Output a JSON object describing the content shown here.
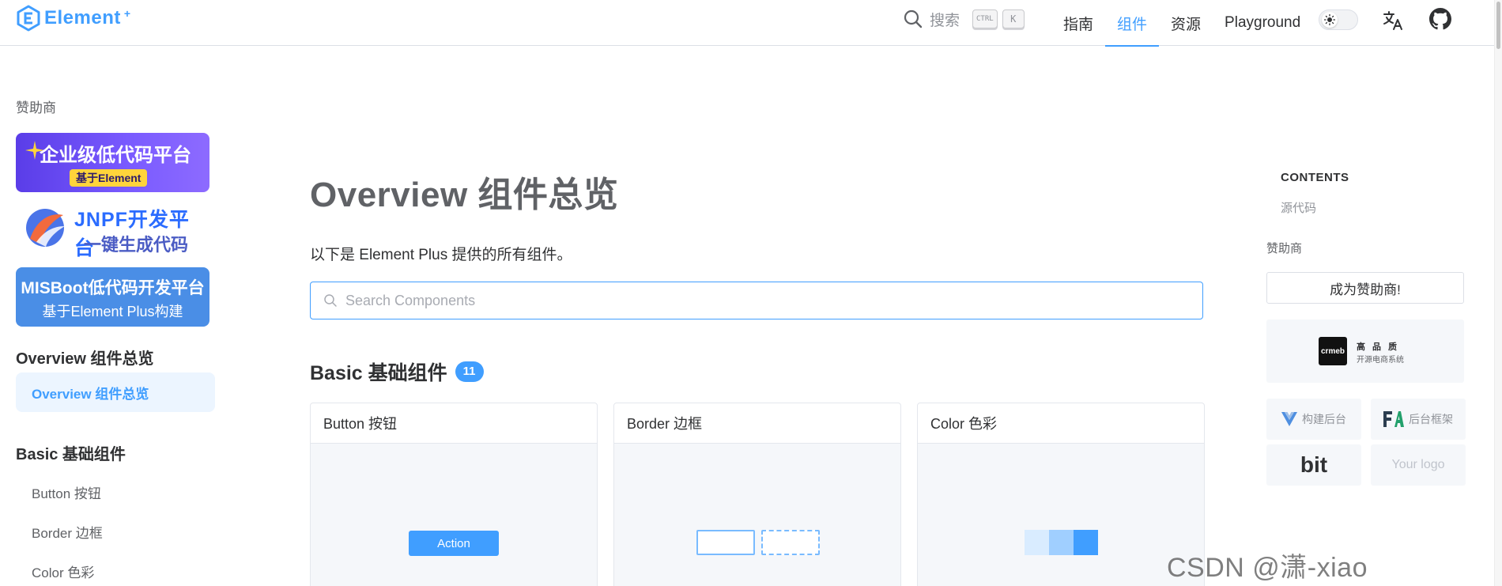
{
  "header": {
    "logo_text": "Element",
    "logo_plus": "+",
    "search_label": "搜索",
    "kbd_ctrl": "CTRL",
    "kbd_k": "K",
    "nav": [
      {
        "label": "指南"
      },
      {
        "label": "组件"
      },
      {
        "label": "资源"
      },
      {
        "label": "Playground"
      }
    ],
    "active_nav": "组件"
  },
  "sidebar": {
    "sponsor_title": "赞助商",
    "ads": [
      {
        "line1": "企业级低代码平台",
        "line2": "基于Element"
      },
      {
        "line1": "JNPF开发平台",
        "line2": "一键生成代码"
      },
      {
        "line1": "MISBoot低代码开发平台",
        "line2": "基于Element Plus构建"
      }
    ],
    "group_overview": "Overview 组件总览",
    "active_item": "Overview 组件总览",
    "group_basic": "Basic 基础组件",
    "items": [
      {
        "label": "Button 按钮"
      },
      {
        "label": "Border 边框"
      },
      {
        "label": "Color 色彩"
      }
    ]
  },
  "main": {
    "title": "Overview 组件总览",
    "description": "以下是 Element Plus 提供的所有组件。",
    "search_placeholder": "Search Components",
    "section_title": "Basic 基础组件",
    "section_count": "11",
    "cards": [
      {
        "title": "Button 按钮",
        "demo_label": "Action"
      },
      {
        "title": "Border 边框"
      },
      {
        "title": "Color 色彩"
      }
    ]
  },
  "aside": {
    "contents_title": "CONTENTS",
    "contents_link": "源代码",
    "sponsor_title": "赞助商",
    "become_sponsor": "成为赞助商!",
    "crmeb_logo": "crmeb",
    "crmeb_line1": "高品质",
    "crmeb_line2": "开源电商系统",
    "tiles": [
      {
        "label": "构建后台"
      },
      {
        "label": "后台框架"
      },
      {
        "label": "bit"
      },
      {
        "label": "Your logo"
      }
    ]
  },
  "watermark": "CSDN @潇-xiao",
  "colors": {
    "primary": "#409eff",
    "primary_light": "#ecf5ff",
    "text_primary": "#303133",
    "text_regular": "#606266",
    "border": "#dcdfe6"
  }
}
